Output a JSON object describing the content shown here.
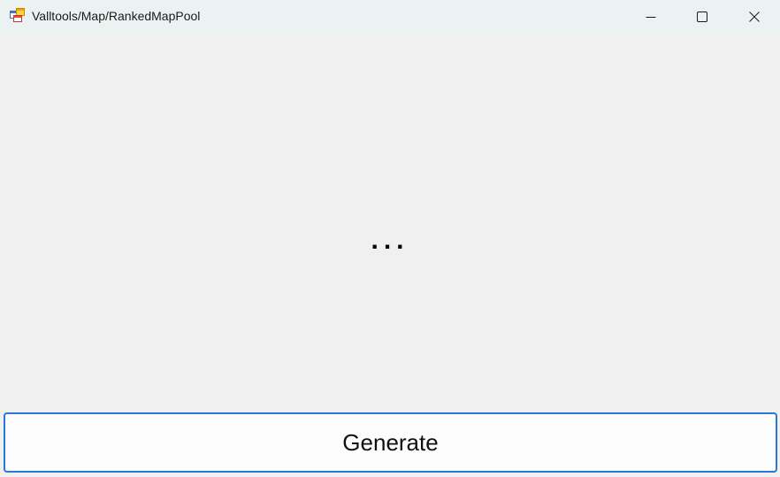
{
  "window": {
    "title": "Valltools/Map/RankedMapPool",
    "icon": "app-window-icon"
  },
  "controls": {
    "minimize_icon": "minimize-icon",
    "maximize_icon": "maximize-icon",
    "close_icon": "close-icon"
  },
  "main": {
    "status_text": "...",
    "generate_label": "Generate"
  },
  "colors": {
    "titlebar_bg": "#eaf3f2",
    "client_bg": "#f0f0f0",
    "button_border": "#2a78d6",
    "button_bg": "#fdfdfd"
  }
}
